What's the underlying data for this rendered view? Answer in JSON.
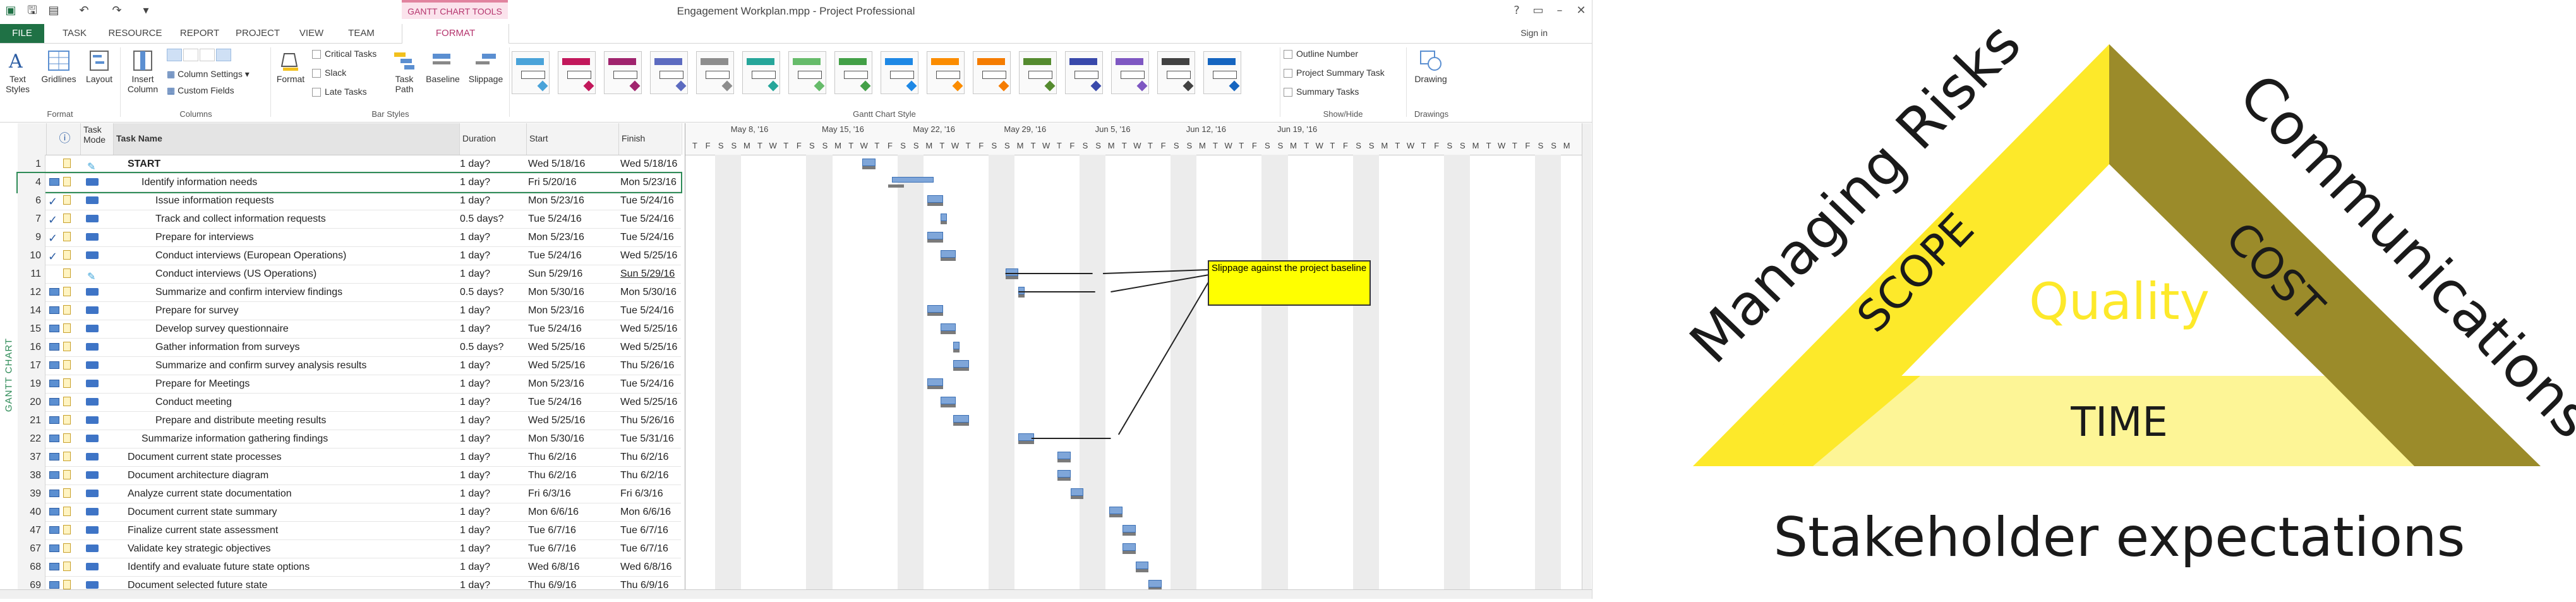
{
  "app": {
    "title": "Engagement Workplan.mpp - Project Professional",
    "tools_title": "GANTT CHART TOOLS",
    "sign_in": "Sign in",
    "help": "?",
    "view_label": "GANTT CHART"
  },
  "tabs": [
    "FILE",
    "TASK",
    "RESOURCE",
    "REPORT",
    "PROJECT",
    "VIEW",
    "TEAM",
    "FORMAT"
  ],
  "ribbon": {
    "format_group": {
      "label": "Format",
      "text_styles": "Text\nStyles",
      "gridlines": "Gridlines",
      "layout": "Layout"
    },
    "columns_group": {
      "label": "Columns",
      "insert_column": "Insert\nColumn",
      "column_settings": "Column Settings",
      "custom_fields": "Custom Fields"
    },
    "bar_styles_group": {
      "label": "Bar Styles",
      "format": "Format",
      "critical_tasks": "Critical Tasks",
      "slack": "Slack",
      "late_tasks": "Late Tasks",
      "task_path": "Task\nPath",
      "baseline": "Baseline",
      "slippage": "Slippage"
    },
    "gantt_style_label": "Gantt Chart Style",
    "show_hide_group": {
      "label": "Show/Hide",
      "outline_number": "Outline Number",
      "project_summary_task": "Project Summary Task",
      "summary_tasks": "Summary Tasks"
    },
    "drawings_group": {
      "label": "Drawings",
      "drawing": "Drawing"
    },
    "style_colors": [
      "#4aa3d9",
      "#c2185b",
      "#a0246e",
      "#5c6bc0",
      "#8d8d8d",
      "#26a69a",
      "#66bb6a",
      "#43a047",
      "#1e88e5",
      "#fb8c00",
      "#f57c00",
      "#558b2f",
      "#3949ab",
      "#7e57c2",
      "#424242",
      "#1565c0"
    ]
  },
  "table": {
    "headers": {
      "indicator": "ⓘ",
      "task_mode": "Task\nMode",
      "task_name": "Task Name",
      "duration": "Duration",
      "start": "Start",
      "finish": "Finish"
    },
    "rows": [
      {
        "id": "1",
        "name": "START",
        "duration": "1 day?",
        "start": "Wed 5/18/16",
        "finish": "Wed 5/18/16",
        "indent": 1,
        "bold": true,
        "ind": "note",
        "mode": "manual"
      },
      {
        "id": "4",
        "name": "Identify information needs",
        "duration": "1 day?",
        "start": "Fri 5/20/16",
        "finish": "Mon 5/23/16",
        "indent": 2,
        "bold": false,
        "ind": "tbl",
        "mode": "auto"
      },
      {
        "id": "6",
        "name": "Issue information requests",
        "duration": "1 day?",
        "start": "Mon 5/23/16",
        "finish": "Tue 5/24/16",
        "indent": 3,
        "bold": false,
        "ind": "chk",
        "mode": "auto"
      },
      {
        "id": "7",
        "name": "Track and collect information requests",
        "duration": "0.5 days?",
        "start": "Tue 5/24/16",
        "finish": "Tue 5/24/16",
        "indent": 3,
        "bold": false,
        "ind": "chk",
        "mode": "auto"
      },
      {
        "id": "9",
        "name": "Prepare for interviews",
        "duration": "1 day?",
        "start": "Mon 5/23/16",
        "finish": "Tue 5/24/16",
        "indent": 3,
        "bold": false,
        "ind": "chk",
        "mode": "auto"
      },
      {
        "id": "10",
        "name": "Conduct interviews (European Operations)",
        "duration": "1 day?",
        "start": "Tue 5/24/16",
        "finish": "Wed 5/25/16",
        "indent": 3,
        "bold": false,
        "ind": "chk",
        "mode": "auto"
      },
      {
        "id": "11",
        "name": "Conduct interviews (US Operations)",
        "duration": "1 day?",
        "start": "Sun 5/29/16",
        "finish": "Sun 5/29/16",
        "indent": 3,
        "bold": false,
        "ind": "note",
        "mode": "manual"
      },
      {
        "id": "12",
        "name": "Summarize and confirm interview findings",
        "duration": "0.5 days?",
        "start": "Mon 5/30/16",
        "finish": "Mon 5/30/16",
        "indent": 3,
        "bold": false,
        "ind": "tbl",
        "mode": "auto"
      },
      {
        "id": "14",
        "name": "Prepare for survey",
        "duration": "1 day?",
        "start": "Mon 5/23/16",
        "finish": "Tue 5/24/16",
        "indent": 3,
        "bold": false,
        "ind": "tbl",
        "mode": "auto"
      },
      {
        "id": "15",
        "name": "Develop survey questionnaire",
        "duration": "1 day?",
        "start": "Tue 5/24/16",
        "finish": "Wed 5/25/16",
        "indent": 3,
        "bold": false,
        "ind": "tbl",
        "mode": "auto"
      },
      {
        "id": "16",
        "name": "Gather information from surveys",
        "duration": "0.5 days?",
        "start": "Wed 5/25/16",
        "finish": "Wed 5/25/16",
        "indent": 3,
        "bold": false,
        "ind": "tbl",
        "mode": "auto"
      },
      {
        "id": "17",
        "name": "Summarize and confirm survey analysis results",
        "duration": "1 day?",
        "start": "Wed 5/25/16",
        "finish": "Thu 5/26/16",
        "indent": 3,
        "bold": false,
        "ind": "tbl",
        "mode": "auto"
      },
      {
        "id": "19",
        "name": "Prepare for Meetings",
        "duration": "1 day?",
        "start": "Mon 5/23/16",
        "finish": "Tue 5/24/16",
        "indent": 3,
        "bold": false,
        "ind": "tbl",
        "mode": "auto"
      },
      {
        "id": "20",
        "name": "Conduct meeting",
        "duration": "1 day?",
        "start": "Tue 5/24/16",
        "finish": "Wed 5/25/16",
        "indent": 3,
        "bold": false,
        "ind": "tbl",
        "mode": "auto"
      },
      {
        "id": "21",
        "name": "Prepare and distribute meeting results",
        "duration": "1 day?",
        "start": "Wed 5/25/16",
        "finish": "Thu 5/26/16",
        "indent": 3,
        "bold": false,
        "ind": "tbl",
        "mode": "auto"
      },
      {
        "id": "22",
        "name": "Summarize information gathering findings",
        "duration": "1 day?",
        "start": "Mon 5/30/16",
        "finish": "Tue 5/31/16",
        "indent": 2,
        "bold": false,
        "ind": "tbl",
        "mode": "auto"
      },
      {
        "id": "37",
        "name": "Document current state processes",
        "duration": "1 day?",
        "start": "Thu 6/2/16",
        "finish": "Thu 6/2/16",
        "indent": 1,
        "bold": false,
        "ind": "tbl",
        "mode": "auto"
      },
      {
        "id": "38",
        "name": "Document architecture diagram",
        "duration": "1 day?",
        "start": "Thu 6/2/16",
        "finish": "Thu 6/2/16",
        "indent": 1,
        "bold": false,
        "ind": "tbl",
        "mode": "auto"
      },
      {
        "id": "39",
        "name": "Analyze current state documentation",
        "duration": "1 day?",
        "start": "Fri 6/3/16",
        "finish": "Fri 6/3/16",
        "indent": 1,
        "bold": false,
        "ind": "tbl",
        "mode": "auto"
      },
      {
        "id": "40",
        "name": "Document current state summary",
        "duration": "1 day?",
        "start": "Mon 6/6/16",
        "finish": "Mon 6/6/16",
        "indent": 1,
        "bold": false,
        "ind": "tbl",
        "mode": "auto"
      },
      {
        "id": "47",
        "name": "Finalize current state assessment",
        "duration": "1 day?",
        "start": "Tue 6/7/16",
        "finish": "Tue 6/7/16",
        "indent": 1,
        "bold": false,
        "ind": "tbl",
        "mode": "auto"
      },
      {
        "id": "67",
        "name": "Validate key strategic objectives",
        "duration": "1 day?",
        "start": "Tue 6/7/16",
        "finish": "Tue 6/7/16",
        "indent": 1,
        "bold": false,
        "ind": "tbl",
        "mode": "auto"
      },
      {
        "id": "68",
        "name": "Identify and evaluate future state options",
        "duration": "1 day?",
        "start": "Wed 6/8/16",
        "finish": "Wed 6/8/16",
        "indent": 1,
        "bold": false,
        "ind": "tbl",
        "mode": "auto"
      },
      {
        "id": "69",
        "name": "Document selected future state",
        "duration": "1 day?",
        "start": "Thu 6/9/16",
        "finish": "Thu 6/9/16",
        "indent": 1,
        "bold": false,
        "ind": "tbl",
        "mode": "auto"
      }
    ]
  },
  "gantt": {
    "weeks": [
      "May 8, '16",
      "May 15, '16",
      "May 22, '16",
      "May 29, '16",
      "Jun 5, '16",
      "Jun 12, '16",
      "Jun 19, '16"
    ],
    "day_letters": [
      "T",
      "F",
      "S",
      "S",
      "M",
      "T",
      "W"
    ],
    "callout": "Slippage against the project baseline"
  },
  "diagram": {
    "left_label": "Managing Risks",
    "right_label": "Communications",
    "scope": "SCOPE",
    "cost": "COST",
    "quality": "Quality",
    "time": "TIME",
    "bottom": "Stakeholder expectations",
    "colors": {
      "yellow": "#fde92a",
      "olive": "#9b8b2a",
      "pale": "#fdf596",
      "text": "#1a1a1a"
    }
  }
}
